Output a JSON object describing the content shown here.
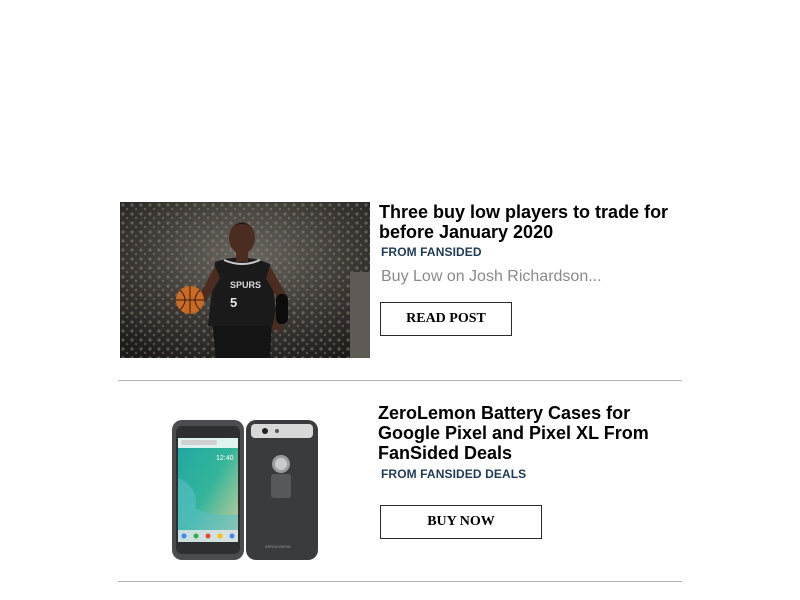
{
  "articles": [
    {
      "title": "Three buy low players to trade for before January 2020",
      "source": "FROM FANSIDED",
      "excerpt": "Buy Low on Josh Richardson...",
      "cta_label": "READ POST",
      "image_alt": "Basketball player in Spurs jersey dribbling",
      "jersey_text": "SPURS",
      "jersey_number": "5"
    },
    {
      "title": "ZeroLemon Battery Cases for Google Pixel and Pixel XL From FanSided Deals",
      "source": "FROM FANSIDED DEALS",
      "cta_label": "BUY NOW",
      "image_alt": "Phone with battery case, front and back views",
      "phone_time": "12:40",
      "case_brand": "ZEROLEMON"
    }
  ],
  "colors": {
    "source_text": "#1f3a57",
    "excerpt_text": "#8a8a8a",
    "divider": "#b4b4b4"
  }
}
